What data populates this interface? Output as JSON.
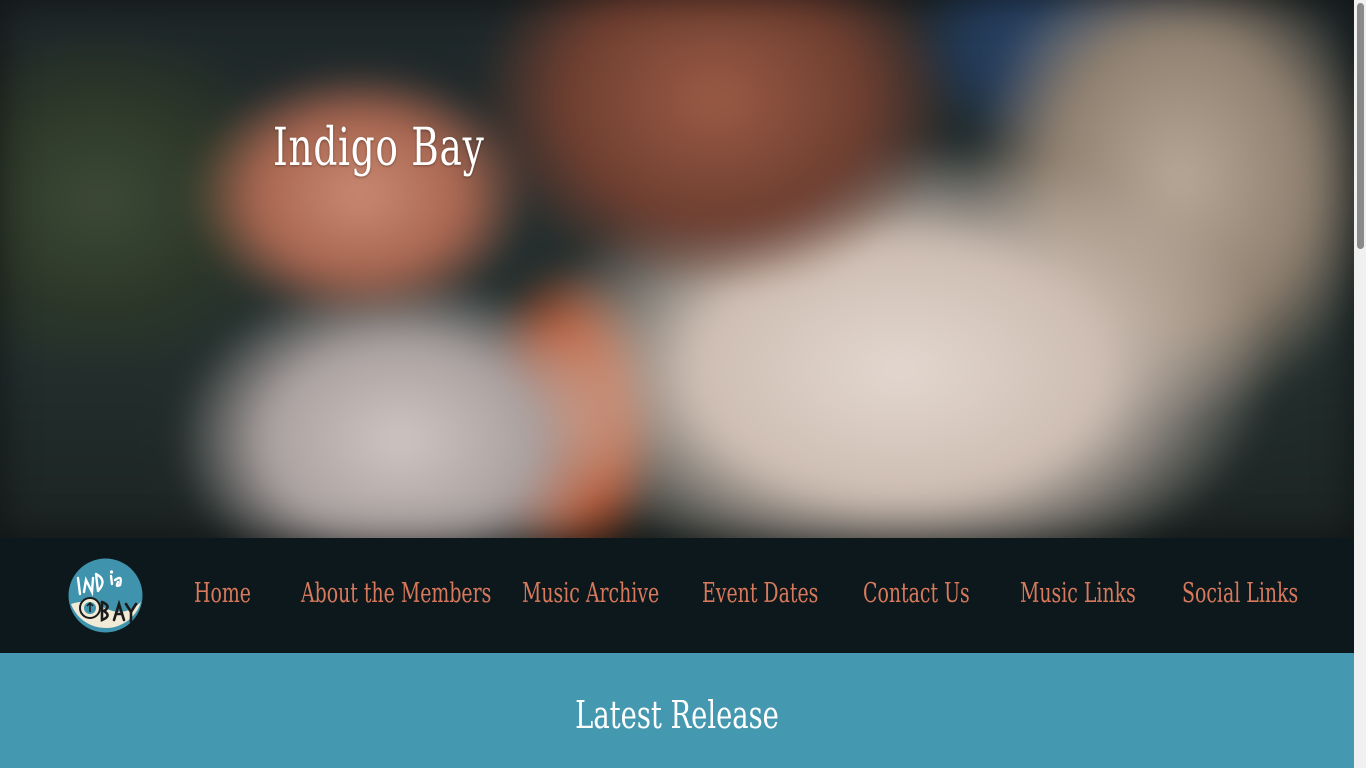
{
  "hero": {
    "title": "Indigo Bay"
  },
  "nav": {
    "logo_icon": "indigo-bay-logo",
    "items": [
      {
        "label": "Home"
      },
      {
        "label": "About the Members"
      },
      {
        "label": "Music Archive"
      },
      {
        "label": "Event Dates"
      },
      {
        "label": "Contact Us"
      },
      {
        "label": "Music Links"
      },
      {
        "label": "Social Links"
      }
    ]
  },
  "release": {
    "heading": "Latest Release"
  },
  "colors": {
    "nav_background": "#0c181b",
    "nav_link": "#d9795c",
    "release_background": "#4499b0",
    "title_text": "#ffffff"
  }
}
